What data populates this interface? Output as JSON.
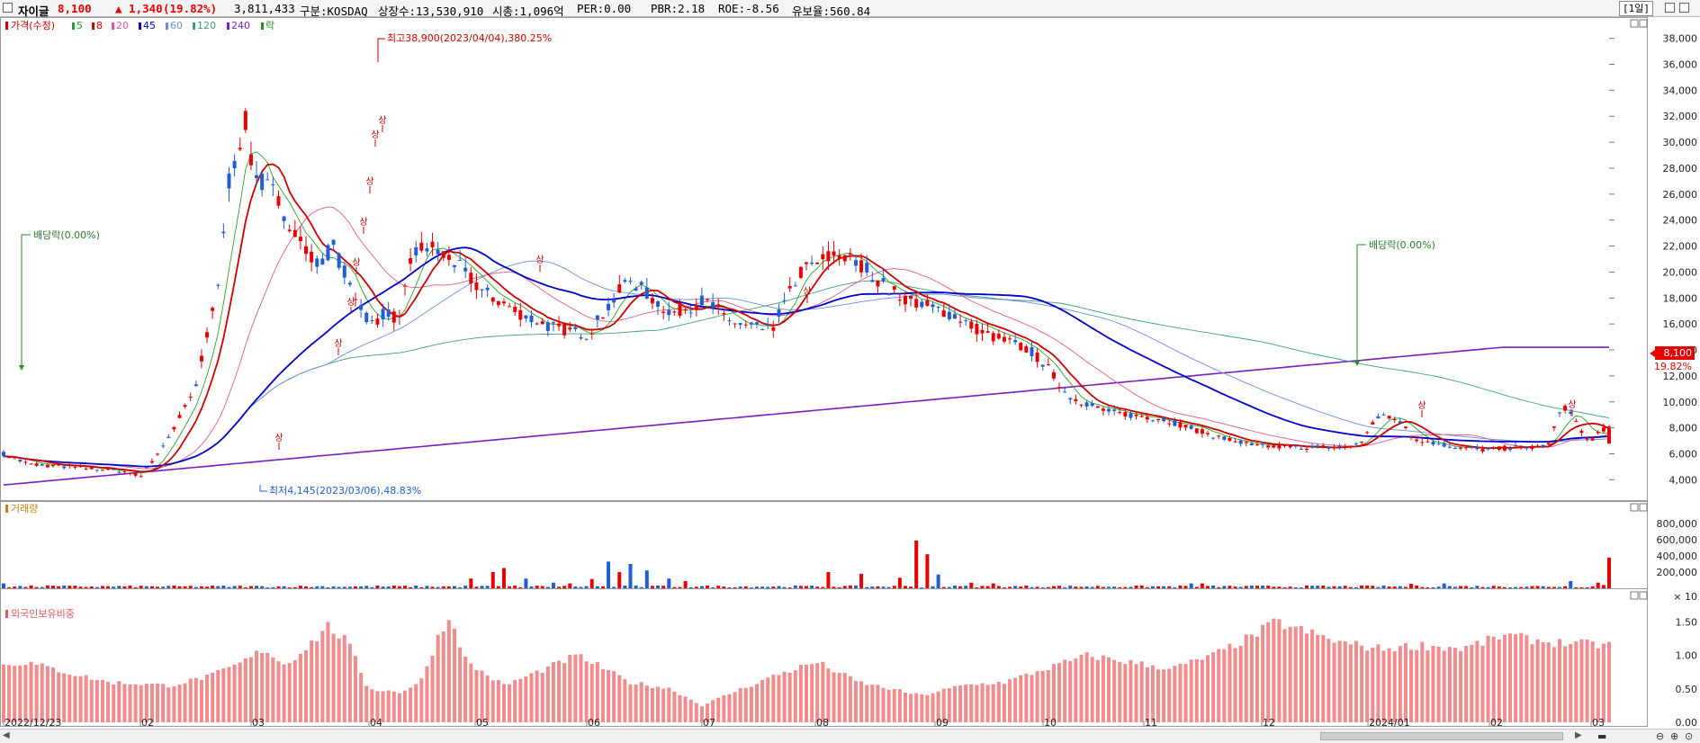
{
  "header": {
    "name": "자이글",
    "price": "8,100",
    "change": "▲ 1,340",
    "change_pct": "(19.82%)",
    "volume": "3,811,433",
    "market": "구분:KOSDAQ",
    "shares": "상장수:13,530,910",
    "mcap": "시총:1,096억",
    "per": "PER:0.00",
    "pbr": "PBR:2.18",
    "roe": "ROE:-8.56",
    "float": "유보율:560.84",
    "period_label": "[1일]"
  },
  "colors": {
    "up": "#e60000",
    "down": "#1f5fd1",
    "ma5": "#2ca02c",
    "ma8": "#cc0000",
    "ma20": "#e05a8c",
    "ma45": "#0000c8",
    "ma60": "#6b8fd6",
    "ma120": "#3fa07a",
    "ma240": "#7a1fbf",
    "foreign": "#f28b8b",
    "price_box": "#e60000"
  },
  "legend": {
    "price": "가격(수정)",
    "items": [
      {
        "label": "5",
        "color": "#2ca02c"
      },
      {
        "label": "8",
        "color": "#cc0000"
      },
      {
        "label": "20",
        "color": "#e05a8c"
      },
      {
        "label": "45",
        "color": "#0000c8"
      },
      {
        "label": "60",
        "color": "#6b8fd6"
      },
      {
        "label": "120",
        "color": "#3fa07a"
      },
      {
        "label": "240",
        "color": "#7a1fbf"
      },
      {
        "label": "락",
        "color": "#2a8a2a"
      }
    ]
  },
  "annotations": {
    "high": "최고38,900(2023/04/04),380.25%",
    "low": "최저4,145(2023/03/06),48.83%",
    "div1": "배당락(0.00%)",
    "div2": "배당락(0.00%)",
    "limit_up": "상",
    "last_price": "8,100",
    "last_pct": "19.82%"
  },
  "chart_data": [
    {
      "type": "candlestick",
      "title": "가격(수정)",
      "x_labels": [
        "2022/12/23",
        "02",
        "03",
        "04",
        "05",
        "06",
        "07",
        "08",
        "09",
        "10",
        "11",
        "12",
        "2024/01",
        "02",
        "03"
      ],
      "y_ticks": [
        "4,000",
        "6,000",
        "8,000",
        "10,000",
        "12,000",
        "14,000",
        "16,000",
        "18,000",
        "20,000",
        "22,000",
        "24,000",
        "26,000",
        "28,000",
        "30,000",
        "32,000",
        "34,000",
        "36,000",
        "38,000"
      ],
      "ylim": [
        2500,
        39500
      ],
      "key_points": [
        {
          "date": "2022/12/23",
          "close": 6000
        },
        {
          "date": "2023/03/06",
          "low": 4145
        },
        {
          "date": "2023/04/04",
          "high": 38900
        },
        {
          "date": "2023/06",
          "close": 21000
        },
        {
          "date": "2023/09",
          "close": 21500
        },
        {
          "date": "2023/11",
          "close": 10000
        },
        {
          "date": "2024/01",
          "close": 6200
        },
        {
          "date": "2024/03",
          "close": 8100
        }
      ],
      "moving_averages": [
        "5",
        "8",
        "20",
        "45",
        "60",
        "120",
        "240"
      ]
    },
    {
      "type": "bar",
      "title": "거래량",
      "y_ticks": [
        "200,000",
        "400,000",
        "600,000",
        "800,000"
      ],
      "y_unit": "× 10",
      "ylim": [
        0,
        1000000
      ]
    },
    {
      "type": "bar",
      "title": "외국인보유비중",
      "y_ticks": [
        "0.00",
        "0.50",
        "1.00",
        "1.50"
      ],
      "ylim": [
        0,
        1.8
      ]
    }
  ]
}
